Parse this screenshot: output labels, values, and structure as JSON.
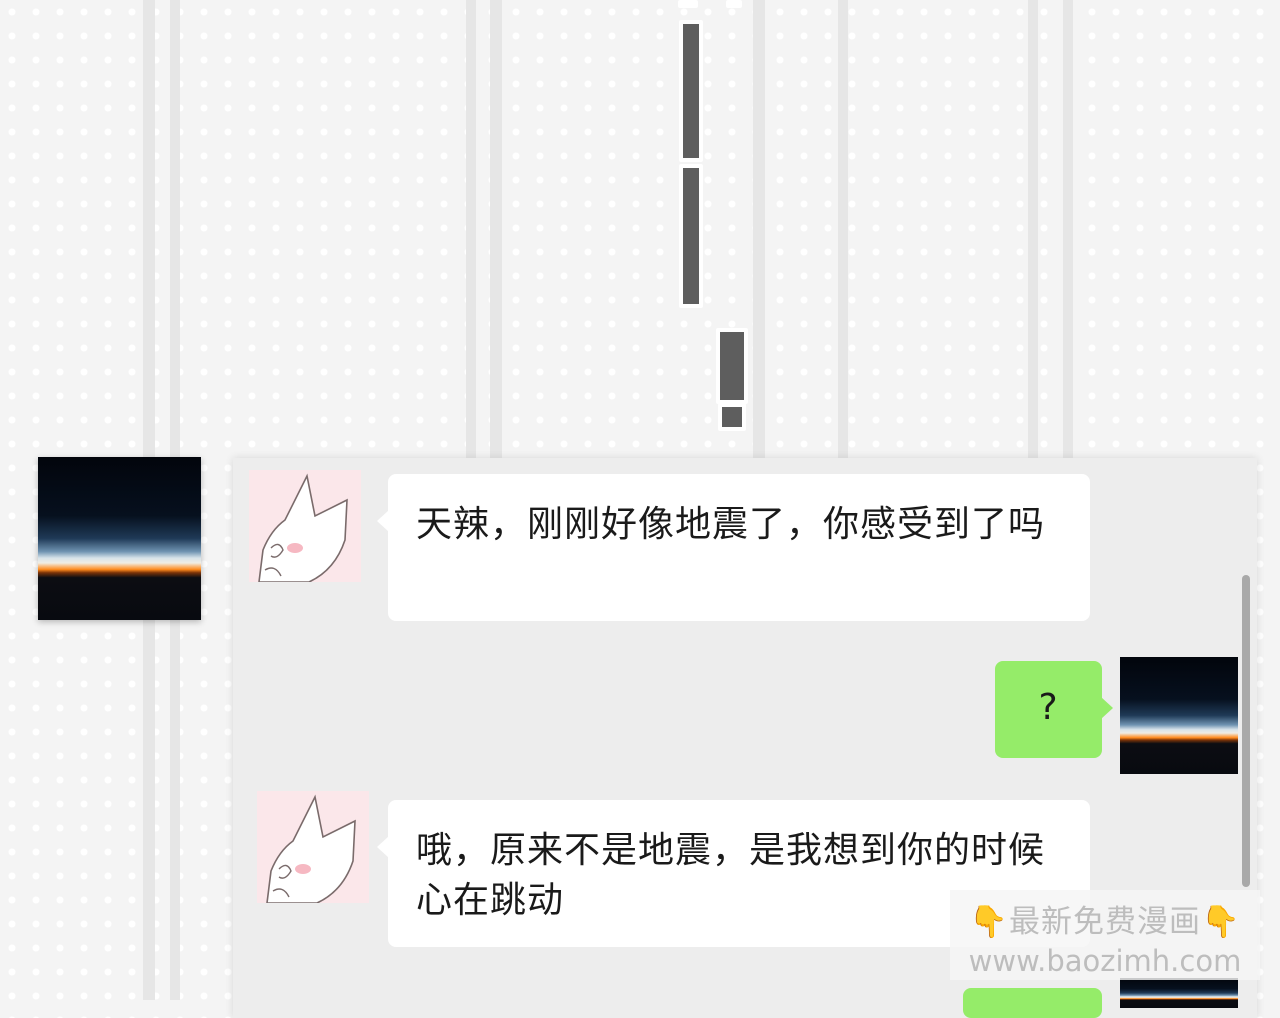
{
  "messages": [
    {
      "side": "left",
      "text": "天辣，刚刚好像地震了，你感受到了吗"
    },
    {
      "side": "right",
      "text": "?"
    },
    {
      "side": "left",
      "text": "哦，原来不是地震，是我想到你的时候心在跳动"
    }
  ],
  "watermark": {
    "line1": "👇最新免费漫画👇",
    "line2": "www.baozimh.com"
  },
  "colors": {
    "green_bubble": "#95ec69",
    "exclamation": "#5e5e5e"
  }
}
